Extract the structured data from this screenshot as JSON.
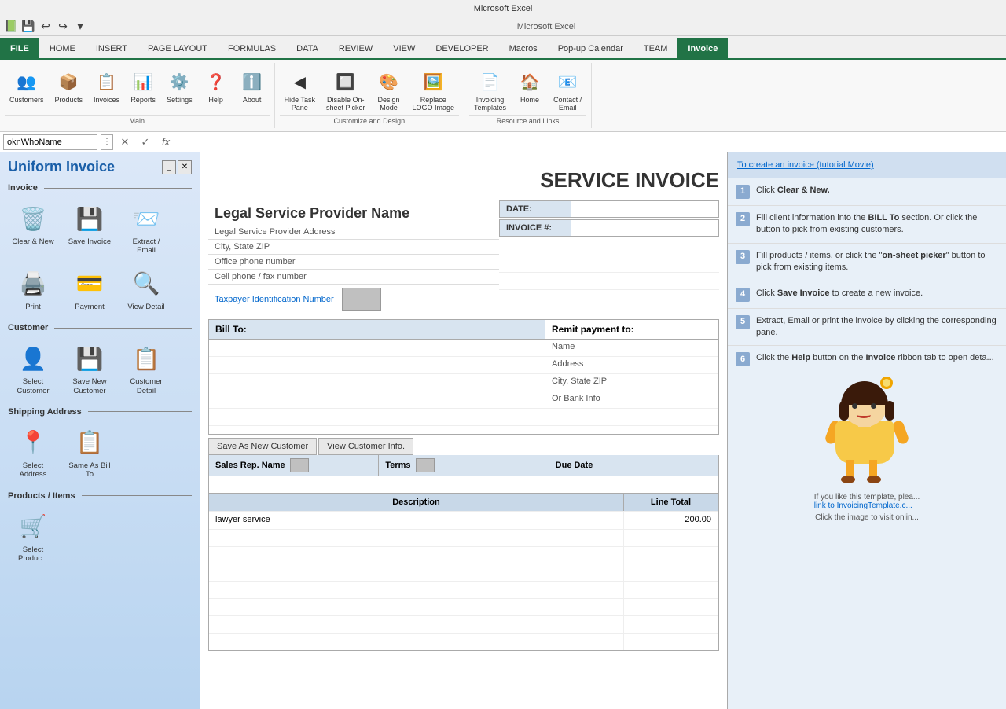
{
  "titleBar": {
    "title": "Microsoft Excel",
    "quickAccess": [
      "save",
      "undo",
      "redo",
      "customize"
    ]
  },
  "tabs": [
    {
      "id": "file",
      "label": "FILE"
    },
    {
      "id": "home",
      "label": "HOME"
    },
    {
      "id": "insert",
      "label": "INSERT"
    },
    {
      "id": "pageLayout",
      "label": "PAGE LAYOUT"
    },
    {
      "id": "formulas",
      "label": "FORMULAS"
    },
    {
      "id": "data",
      "label": "DATA"
    },
    {
      "id": "review",
      "label": "REVIEW"
    },
    {
      "id": "view",
      "label": "VIEW"
    },
    {
      "id": "developer",
      "label": "DEVELOPER"
    },
    {
      "id": "macros",
      "label": "Macros"
    },
    {
      "id": "popupCalendar",
      "label": "Pop-up Calendar"
    },
    {
      "id": "team",
      "label": "TEAM"
    },
    {
      "id": "invoice",
      "label": "Invoice",
      "active": true
    }
  ],
  "ribbon": {
    "groups": [
      {
        "id": "main",
        "label": "Main",
        "buttons": [
          {
            "id": "customers",
            "label": "Customers",
            "icon": "👥"
          },
          {
            "id": "products",
            "label": "Products",
            "icon": "📦"
          },
          {
            "id": "invoices",
            "label": "Invoices",
            "icon": "📋"
          },
          {
            "id": "reports",
            "label": "Reports",
            "icon": "📊"
          },
          {
            "id": "settings",
            "label": "Settings",
            "icon": "⚙️"
          },
          {
            "id": "help",
            "label": "Help",
            "icon": "❓"
          },
          {
            "id": "about",
            "label": "About",
            "icon": "ℹ️"
          }
        ]
      },
      {
        "id": "customizeDesign",
        "label": "Customize and Design",
        "buttons": [
          {
            "id": "hideTaskPane",
            "label": "Hide Task\nPane",
            "icon": "◀"
          },
          {
            "id": "disableOnsheet",
            "label": "Disable On-\nsheet Picker",
            "icon": "🔲"
          },
          {
            "id": "designMode",
            "label": "Design\nMode",
            "icon": "🎨"
          },
          {
            "id": "replaceLogoImage",
            "label": "Replace\nLOGO Image",
            "icon": "🖼️"
          }
        ]
      },
      {
        "id": "resourceLinks",
        "label": "Resource and Links",
        "buttons": [
          {
            "id": "invoicingTemplates",
            "label": "Invoicing\nTemplates",
            "icon": "📄"
          },
          {
            "id": "home",
            "label": "Home",
            "icon": "🏠"
          },
          {
            "id": "contactEmail",
            "label": "Contact /\nEmail",
            "icon": "📧"
          }
        ]
      }
    ]
  },
  "formulaBar": {
    "nameBox": "oknWhoName",
    "formula": ""
  },
  "taskPane": {
    "title": "Uniform Invoice",
    "sections": [
      {
        "id": "invoice",
        "label": "Invoice",
        "items": [
          {
            "id": "clearNew",
            "label": "Clear & New",
            "icon": "🗑️"
          },
          {
            "id": "saveInvoice",
            "label": "Save Invoice",
            "icon": "💾"
          },
          {
            "id": "extractEmail",
            "label": "Extract /\nEmail",
            "icon": "📨"
          },
          {
            "id": "print",
            "label": "Print",
            "icon": "🖨️"
          },
          {
            "id": "payment",
            "label": "Payment",
            "icon": "💳"
          },
          {
            "id": "viewDetail",
            "label": "View Detail",
            "icon": "🔍"
          }
        ]
      },
      {
        "id": "customer",
        "label": "Customer",
        "items": [
          {
            "id": "selectCustomer",
            "label": "Select\nCustomer",
            "icon": "👤"
          },
          {
            "id": "saveNewCustomer",
            "label": "Save New\nCustomer",
            "icon": "💾"
          },
          {
            "id": "customerDetail",
            "label": "Customer\nDetail",
            "icon": "📋"
          }
        ]
      },
      {
        "id": "shippingAddress",
        "label": "Shipping Address",
        "items": [
          {
            "id": "selectAddress",
            "label": "Select\nAddress",
            "icon": "📍"
          },
          {
            "id": "sameAsBillTo",
            "label": "Same As Bill\nTo",
            "icon": "📋"
          }
        ]
      },
      {
        "id": "productsItems",
        "label": "Products / Items",
        "items": [
          {
            "id": "selectProduct",
            "label": "Select\nProduc...",
            "icon": "🛒"
          }
        ]
      }
    ]
  },
  "invoice": {
    "title": "SERVICE INVOICE",
    "provider": {
      "name": "Legal Service Provider Name",
      "address": "Legal Service Provider Address",
      "cityStateZip": "City, State ZIP",
      "officePhone": "Office phone number",
      "cellFax": "Cell phone / fax number",
      "taxIdLabel": "Taxpayer Identification Number"
    },
    "dateLabel": "DATE:",
    "dateValue": "",
    "invoiceNumLabel": "INVOICE #:",
    "invoiceNumValue": "",
    "billTo": {
      "header": "Bill To:",
      "lines": [
        "",
        "",
        "",
        "",
        ""
      ]
    },
    "remitTo": {
      "header": "Remit payment to:",
      "name": "Name",
      "address": "Address",
      "cityStateZip": "City, State ZIP",
      "bankInfo": "Or Bank Info"
    },
    "customerActions": [
      {
        "id": "saveAsNewCustomer",
        "label": "Save As New Customer"
      },
      {
        "id": "viewCustomerInfo",
        "label": "View Customer Info."
      }
    ],
    "salesRep": {
      "label": "Sales Rep. Name",
      "termsLabel": "Terms",
      "dueDateLabel": "Due Date"
    },
    "descriptionTable": {
      "headers": [
        {
          "id": "description",
          "label": "Description"
        },
        {
          "id": "lineTotal",
          "label": "Line Total"
        }
      ],
      "rows": [
        {
          "description": "lawyer service",
          "lineTotal": "200.00"
        }
      ]
    }
  },
  "helpPanel": {
    "tutorialLink": "To create an invoice (tutorial Movie)",
    "steps": [
      {
        "num": 1,
        "text": "Click Clear & New.",
        "boldParts": [
          "Clear & New."
        ]
      },
      {
        "num": 2,
        "text": "Fill client information into the BILL To section. Or click the button to pick from existing customers.",
        "boldParts": [
          "BILL To"
        ]
      },
      {
        "num": 3,
        "text": "Fill products / items, or click the \"on-sheet picker\" button to pick from existing items.",
        "boldParts": [
          "on-sheet picker"
        ]
      },
      {
        "num": 4,
        "text": "Click Save Invoice to create a new invoice.",
        "boldParts": [
          "Save Invoice"
        ]
      },
      {
        "num": 5,
        "text": "Extract, Email or print the invoice by clicking the corresponding pane.",
        "boldParts": []
      },
      {
        "num": 6,
        "text": "Click the Help button on the Invoice ribbon tab to open detailed help.",
        "boldParts": [
          "Help",
          "Invoice"
        ]
      }
    ],
    "charText": "If you like this template, plea...",
    "charLinkText": "link to InvoicingTemplate.c...",
    "charLinkText2": "Click the image to visit onlin..."
  }
}
